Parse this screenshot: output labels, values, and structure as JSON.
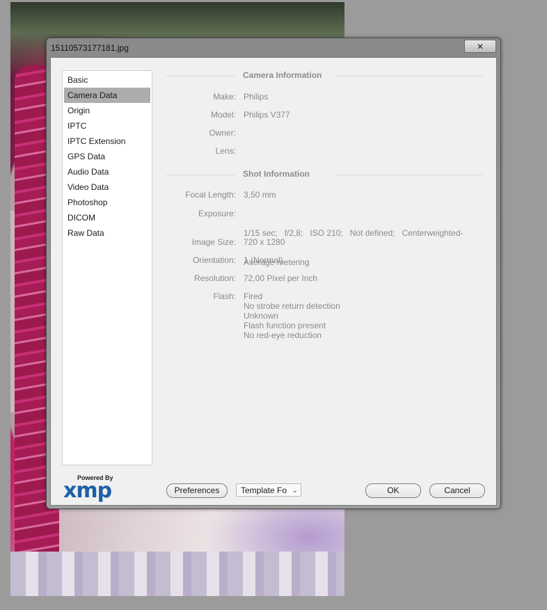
{
  "window": {
    "title": "15110573177181.jpg",
    "close_glyph": "✕"
  },
  "sidebar": {
    "items": [
      {
        "label": "Basic",
        "selected": false
      },
      {
        "label": "Camera Data",
        "selected": true
      },
      {
        "label": "Origin",
        "selected": false
      },
      {
        "label": "IPTC",
        "selected": false
      },
      {
        "label": "IPTC Extension",
        "selected": false
      },
      {
        "label": "GPS Data",
        "selected": false
      },
      {
        "label": "Audio Data",
        "selected": false
      },
      {
        "label": "Video Data",
        "selected": false
      },
      {
        "label": "Photoshop",
        "selected": false
      },
      {
        "label": "DICOM",
        "selected": false
      },
      {
        "label": "Raw Data",
        "selected": false
      }
    ]
  },
  "camera_info": {
    "heading": "Camera Information",
    "fields": [
      {
        "label": "Make:",
        "value": "Philips"
      },
      {
        "label": "Model:",
        "value": "Philips V377"
      },
      {
        "label": "Owner:",
        "value": ""
      },
      {
        "label": "Lens:",
        "value": ""
      }
    ]
  },
  "shot_info": {
    "heading": "Shot Information",
    "focal_length": {
      "label": "Focal Length:",
      "value": "3,50 mm"
    },
    "exposure": {
      "label": "Exposure:",
      "line1": "1/15 sec;   f/2,8;   ISO 210;   Not defined;   Centerweighted-",
      "line2": "Average metering"
    },
    "image_size": {
      "label": "Image Size:",
      "value": "720 x 1280"
    },
    "orientation": {
      "label": "Orientation:",
      "value": "1 (Normal)"
    },
    "resolution": {
      "label": "Resolution:",
      "value": "72,00 Pixel per Inch"
    },
    "flash": {
      "label": "Flash:",
      "lines": [
        "Fired",
        "No strobe return detection",
        "Unknown",
        "Flash function present",
        "No red-eye reduction"
      ]
    }
  },
  "footer": {
    "logo_powered": "Powered By",
    "logo_text": "xmp",
    "preferences_label": "Preferences",
    "template_label": "Template Fo",
    "ok_label": "OK",
    "cancel_label": "Cancel"
  },
  "colors": {
    "selected_item": "#adadad",
    "logo_blue": "#1e5fa8",
    "label_gray": "#8a8a8a"
  }
}
